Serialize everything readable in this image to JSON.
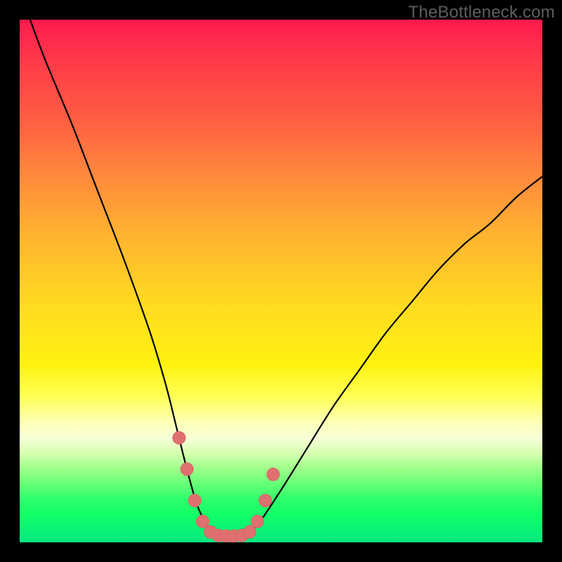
{
  "watermark": "TheBottleneck.com",
  "chart_data": {
    "type": "line",
    "title": "",
    "xlabel": "",
    "ylabel": "",
    "xlim": [
      0,
      100
    ],
    "ylim": [
      0,
      100
    ],
    "grid": false,
    "annotations": [
      "TheBottleneck.com"
    ],
    "background": "vertical heat gradient (red → orange → yellow → pale → green)",
    "series": [
      {
        "name": "curve",
        "color": "#000000",
        "x": [
          2,
          5,
          10,
          15,
          20,
          25,
          28,
          30,
          32,
          34,
          36,
          37,
          38,
          40,
          42,
          44,
          46,
          50,
          55,
          60,
          65,
          70,
          75,
          80,
          85,
          90,
          95,
          100
        ],
        "y": [
          100,
          92,
          80,
          67,
          54,
          40,
          30,
          22,
          14,
          7,
          3,
          1.5,
          1.2,
          1.2,
          1.2,
          2,
          4,
          10,
          18,
          26,
          33,
          40,
          46,
          52,
          57,
          61,
          66,
          70
        ]
      },
      {
        "name": "highlight-dots",
        "color": "#e07070",
        "type": "scatter",
        "x": [
          30.5,
          32,
          33.5,
          35,
          36.5,
          38,
          39.5,
          41,
          42.5,
          44,
          45.5,
          47,
          48.5
        ],
        "y": [
          20,
          14,
          8,
          4,
          2,
          1.3,
          1.2,
          1.2,
          1.3,
          2,
          4,
          8,
          13
        ]
      }
    ]
  },
  "colors": {
    "curve": "#000000",
    "dots": "#e07070",
    "dot_stroke": "#d86666"
  }
}
